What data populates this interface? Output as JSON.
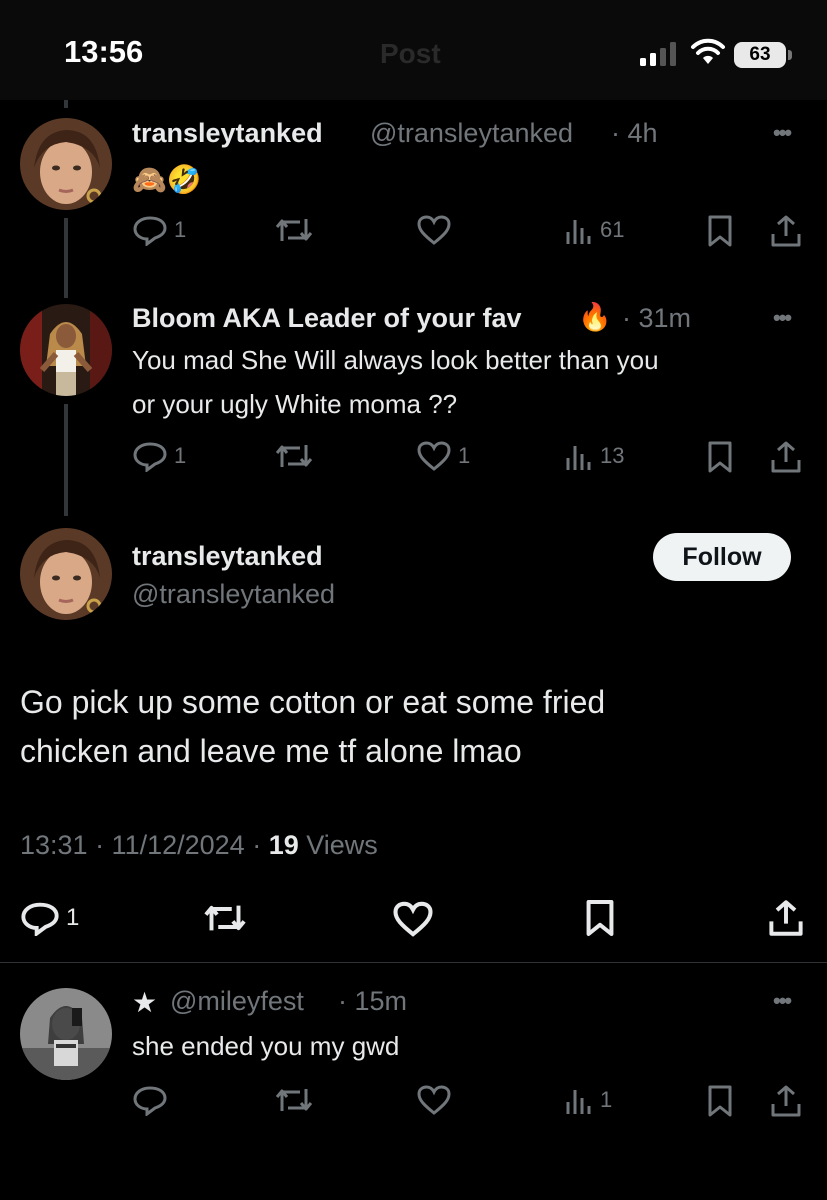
{
  "status_bar": {
    "time": "13:56",
    "battery": "63",
    "faded_header": "Post"
  },
  "tweets": [
    {
      "name": "transleytanked",
      "handle": "@transleytanked",
      "time": "· 4h",
      "emoji": "🙈🤣",
      "replies": "1",
      "likes": "",
      "views": "61"
    },
    {
      "name": "Bloom AKA Leader of your fav",
      "name_emoji": "🔥",
      "time": "· 31m",
      "text_lines": [
        "You mad She Will always look better than you",
        "or your ugly White moma ??"
      ],
      "replies": "1",
      "likes": "1",
      "views": "13"
    }
  ],
  "main_tweet": {
    "name": "transleytanked",
    "handle": "@transleytanked",
    "follow_label": "Follow",
    "text_lines": [
      "Go pick up some cotton or eat some fried",
      "chicken and leave me tf alone lmao"
    ],
    "time_date": "13:31 · 11/12/2024 ·",
    "views_count": "19",
    "views_label": "Views",
    "replies": "1"
  },
  "reply": {
    "star": "★",
    "handle": "@mileyfest",
    "time": "· 15m",
    "text": "she ended you my gwd",
    "views": "1"
  },
  "colors": {
    "background": "#000000",
    "text": "#e7e9ea",
    "muted": "#71767b",
    "thread_line": "#333639"
  }
}
